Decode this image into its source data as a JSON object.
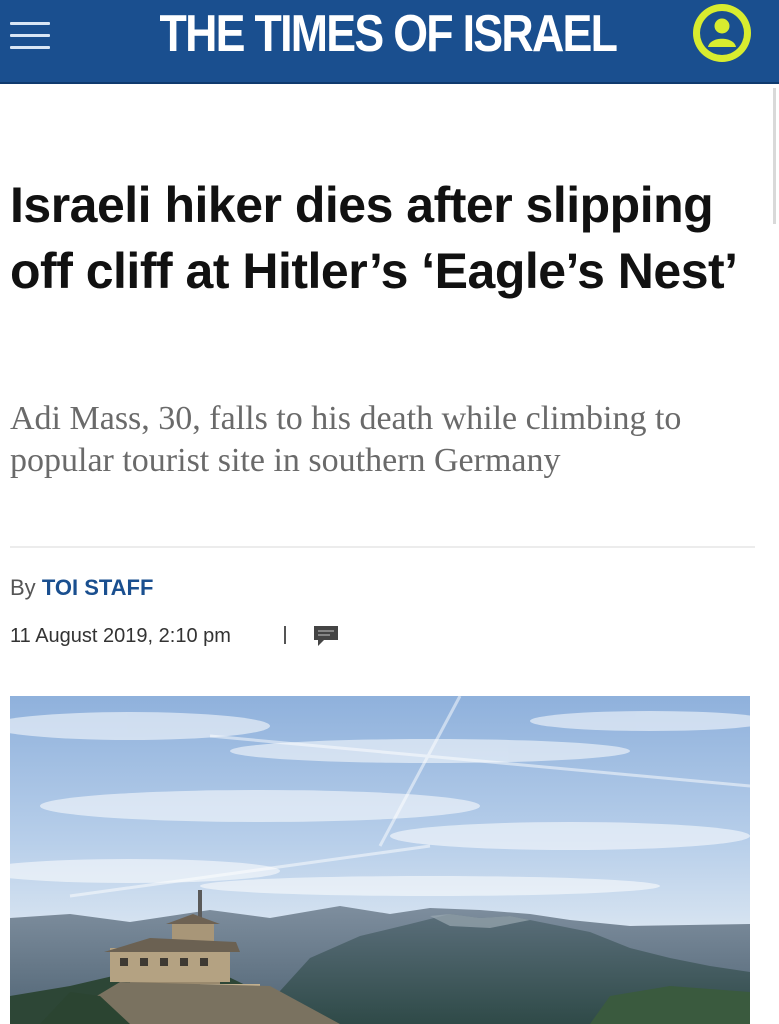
{
  "header": {
    "brand": "THE TIMES OF ISRAEL",
    "menu_icon": "hamburger-menu-icon",
    "account_icon": "user-account-icon",
    "bar_color": "#1a4f8f",
    "account_color": "#d8ec2f"
  },
  "article": {
    "headline": "Israeli hiker dies after slipping off cliff at Hitler’s ‘Eagle’s Nest’",
    "subhead": "Adi Mass, 30, falls to his death while climbing to popular tourist site in southern Germany",
    "byline_prefix": "By",
    "author": "TOI STAFF",
    "date": "11 August 2019, 2:10 pm",
    "comment_icon": "comment-icon",
    "hero_image": "mountain-landscape-image"
  }
}
